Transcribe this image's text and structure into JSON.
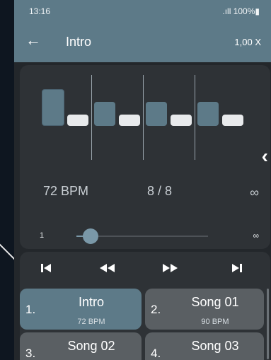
{
  "status": {
    "time": "13:16",
    "signal": ".ıll 100%▮"
  },
  "appbar": {
    "title": "Intro",
    "speed": "1,00 X"
  },
  "metronome": {
    "bpm": "72 BPM",
    "meter": "8 / 8",
    "repeat": "∞"
  },
  "slider": {
    "min": "1",
    "max": "∞",
    "value_fraction": 0.0
  },
  "transport": [
    "skip-to-start",
    "rewind",
    "fast-forward",
    "skip-to-end"
  ],
  "songs": [
    {
      "num": "1.",
      "name": "Intro",
      "tempo": "72 BPM",
      "active": true
    },
    {
      "num": "2.",
      "name": "Song 01",
      "tempo": "90 BPM",
      "active": false
    },
    {
      "num": "3.",
      "name": "Song 02",
      "tempo": "",
      "active": false
    },
    {
      "num": "4.",
      "name": "Song 03",
      "tempo": "",
      "active": false
    }
  ],
  "colors": {
    "header": "#5d7a88",
    "panel": "#2e3236",
    "accent_beat": "#5d7a88",
    "beat": "#e8eaec",
    "song_active": "#5d7a88",
    "song": "#5a5f63"
  }
}
